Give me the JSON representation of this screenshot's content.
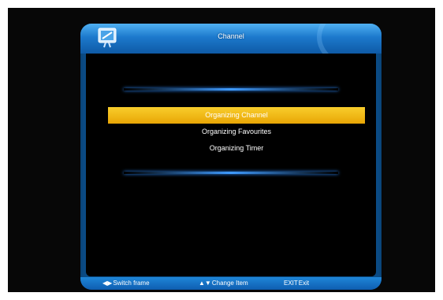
{
  "header": {
    "title": "Channel",
    "icon": "tv-icon"
  },
  "menu": {
    "items": [
      {
        "label": "Organizing Channel",
        "selected": true
      },
      {
        "label": "Organizing Favourites",
        "selected": false
      },
      {
        "label": "Organizing Timer",
        "selected": false
      }
    ]
  },
  "footer": {
    "hints": [
      {
        "key": "◀▶",
        "label": "Switch frame",
        "icon": "left-right-arrows-icon"
      },
      {
        "key": "▲▼",
        "label": "Change Item",
        "icon": "up-down-arrows-icon"
      },
      {
        "key": "EXIT",
        "label": "Exit",
        "icon": "exit-key"
      }
    ]
  },
  "colors": {
    "frame_blue": "#0b4c86",
    "highlight_yellow": "#f3b814",
    "glow_blue": "#3f9bff"
  }
}
